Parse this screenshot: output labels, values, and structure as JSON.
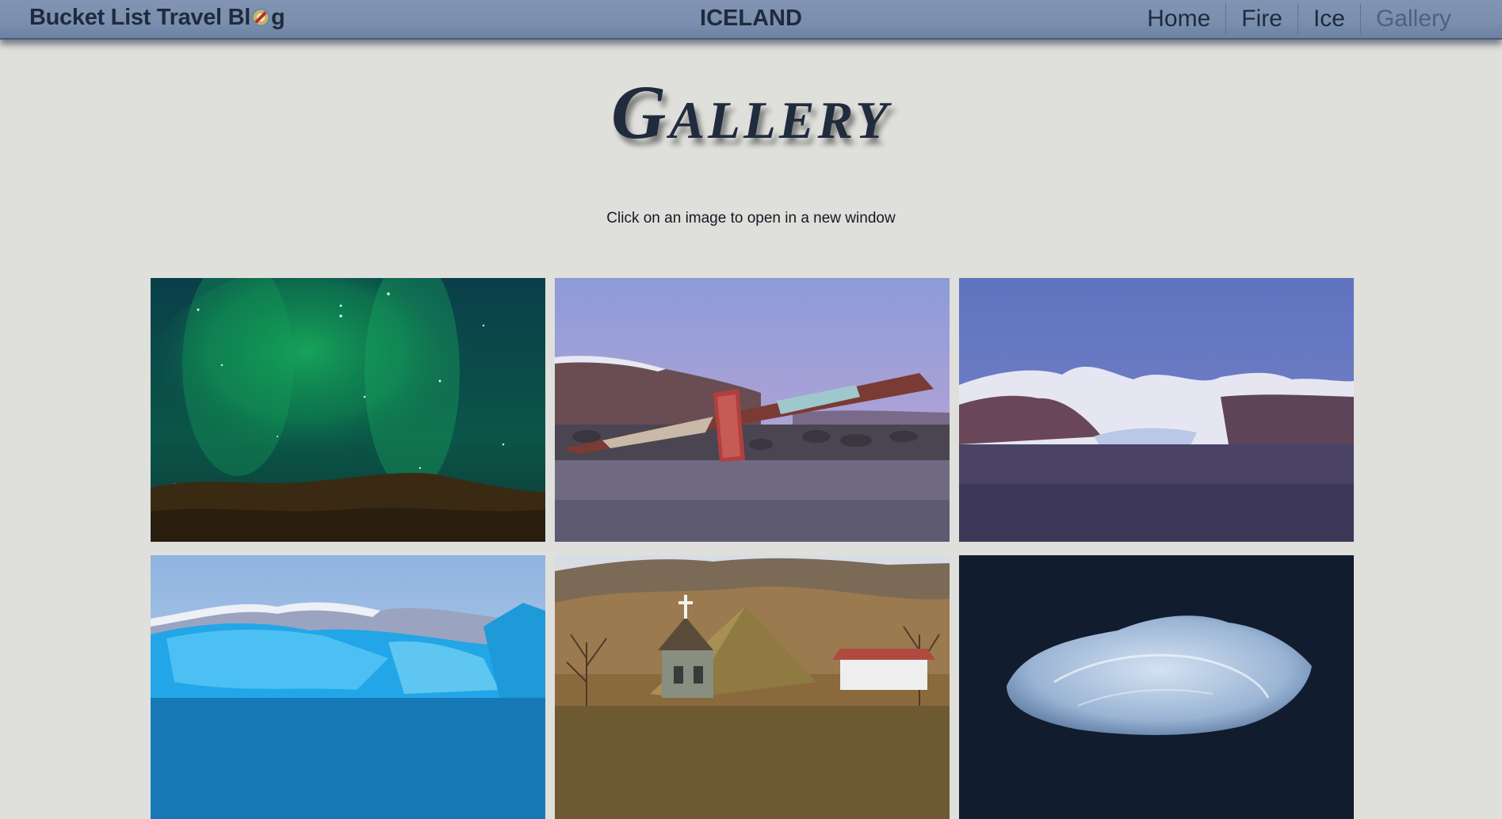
{
  "header": {
    "brand_prefix": "Bucket List Travel Bl",
    "brand_suffix": "g",
    "brand_logo_icon": "compass-icon",
    "site_title": "ICELAND",
    "nav": [
      {
        "label": "Home",
        "active": false
      },
      {
        "label": "Fire",
        "active": false
      },
      {
        "label": "Ice",
        "active": false
      },
      {
        "label": "Gallery",
        "active": true
      }
    ]
  },
  "main": {
    "heading": "Gallery",
    "instruction": "Click on an image to open in a new window"
  },
  "gallery": {
    "images": [
      {
        "subject": "northern-lights"
      },
      {
        "subject": "bridge-monument"
      },
      {
        "subject": "snowy-mountains-glacier"
      },
      {
        "subject": "glacier-lagoon-icebergs"
      },
      {
        "subject": "turf-church"
      },
      {
        "subject": "ice-chunk-black-sand"
      }
    ]
  },
  "colors": {
    "page_background": "#dfdfdb",
    "header_bar": "#7a8eae",
    "text_dark": "#1f2a3d",
    "nav_active": "#4e6180"
  }
}
